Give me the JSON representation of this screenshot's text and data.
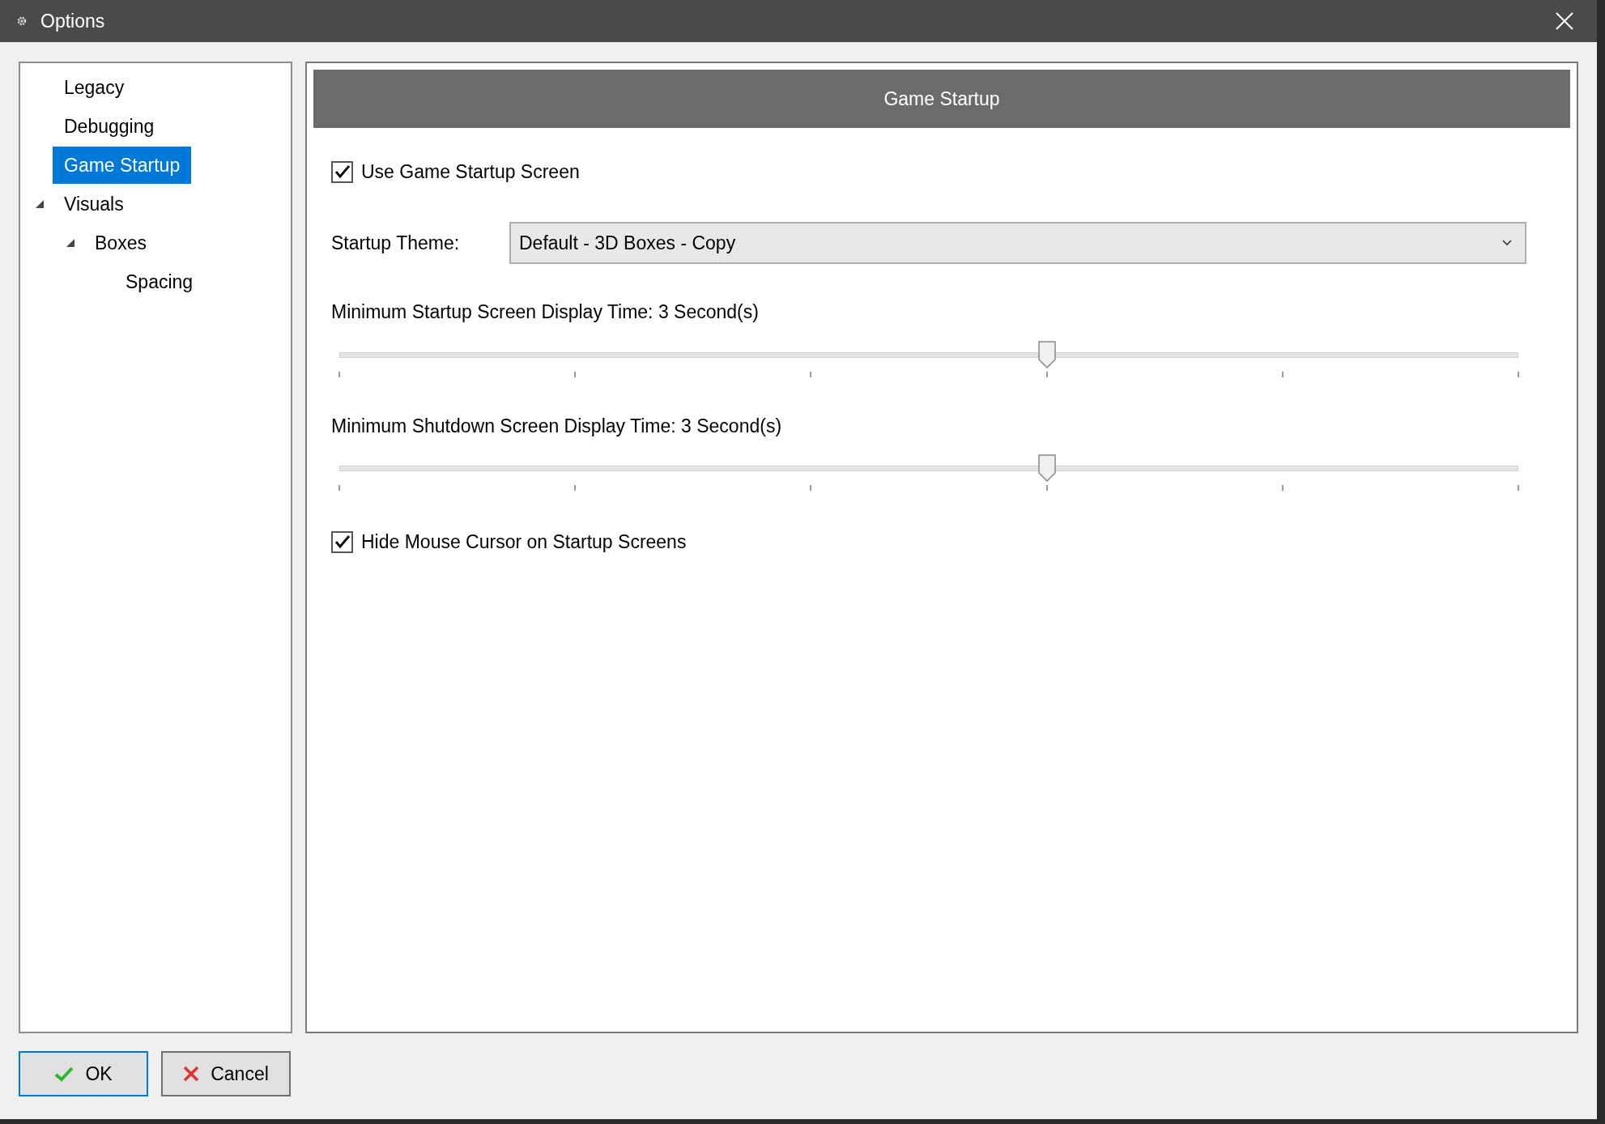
{
  "window": {
    "title": "Options"
  },
  "tree": [
    {
      "label": "Legacy",
      "selected": false
    },
    {
      "label": "Debugging",
      "selected": false
    },
    {
      "label": "Game Startup",
      "selected": true
    },
    {
      "label": "Visuals",
      "selected": false,
      "expanded": true,
      "children": [
        {
          "label": "Boxes",
          "selected": false,
          "expanded": true,
          "children": [
            {
              "label": "Spacing",
              "selected": false
            }
          ]
        }
      ]
    }
  ],
  "panel": {
    "title": "Game Startup",
    "settings": [
      {
        "kind": "checkbox",
        "label": "Use Game Startup Screen",
        "checked": true
      },
      {
        "kind": "dropdown",
        "label": "Startup Theme:",
        "value": "Default - 3D Boxes - Copy"
      },
      {
        "kind": "slider",
        "label": "Minimum Startup Screen Display Time: 3 Second(s)",
        "level": 0.6
      },
      {
        "kind": "slider",
        "label": "Minimum Shutdown Screen Display Time: 3 Second(s)",
        "level": 0.6
      },
      {
        "kind": "checkbox",
        "label": "Hide Mouse Cursor on Startup Screens",
        "checked": true
      }
    ]
  },
  "buttons": [
    {
      "kind": "ok",
      "label": "OK"
    },
    {
      "kind": "cancel",
      "label": "Cancel"
    }
  ]
}
